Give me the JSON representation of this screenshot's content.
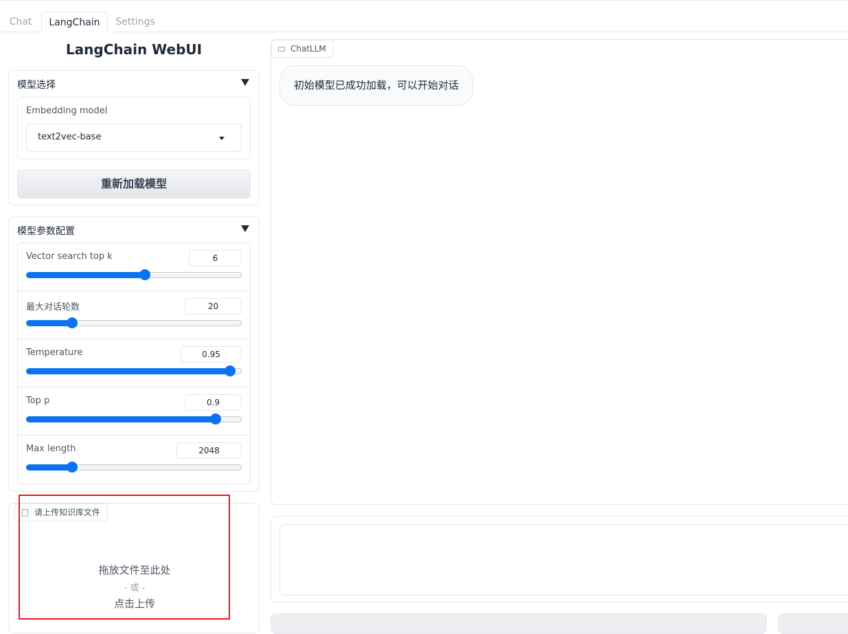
{
  "tabs": [
    "Chat",
    "LangChain",
    "Settings"
  ],
  "app_title": "LangChain WebUI",
  "model_select": {
    "header": "模型选择",
    "embedding_label": "Embedding model",
    "embedding_value": "text2vec-base",
    "reload_button": "重新加载模型"
  },
  "params": {
    "header": "模型参数配置",
    "sliders": [
      {
        "label": "Vector search top k",
        "value": "6",
        "fraction": 0.55
      },
      {
        "label": "最大对话轮数",
        "value": "20",
        "fraction": 0.21
      },
      {
        "label": "Temperature",
        "value": "0.95",
        "fraction": 0.95
      },
      {
        "label": "Top p",
        "value": "0.9",
        "fraction": 0.88
      },
      {
        "label": "Max length",
        "value": "2048",
        "fraction": 0.21
      }
    ]
  },
  "upload": {
    "tag_label": "请上传知识库文件",
    "drop_text": "拖放文件至此处",
    "or_text": "- 或 -",
    "click_text": "点击上传"
  },
  "chat": {
    "tag_label": "ChatLLM",
    "message": "初始模型已成功加载，可以开始对话"
  },
  "colors": {
    "accent": "#0b73f0",
    "highlight_box": "#e8161b"
  }
}
